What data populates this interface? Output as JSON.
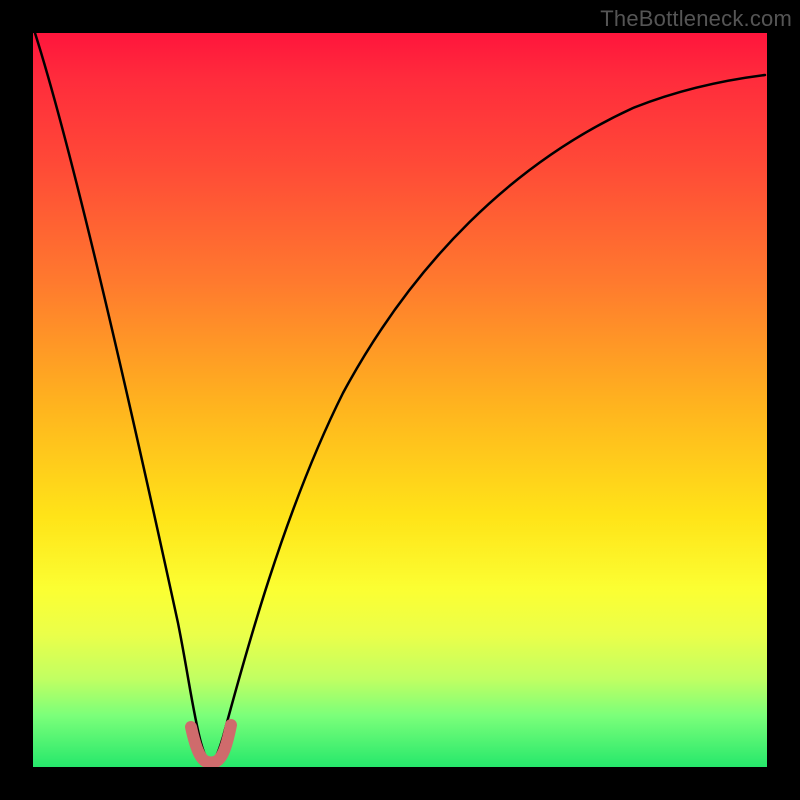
{
  "watermark": "TheBottleneck.com",
  "chart_data": {
    "type": "line",
    "title": "",
    "xlabel": "",
    "ylabel": "",
    "xlim": [
      0,
      100
    ],
    "ylim": [
      0,
      100
    ],
    "grid": false,
    "legend": false,
    "series": [
      {
        "name": "bottleneck-curve",
        "color": "#000000",
        "x": [
          0,
          4,
          8,
          12,
          16,
          18,
          20,
          21,
          22,
          23,
          24,
          25,
          26,
          28,
          32,
          36,
          40,
          46,
          52,
          60,
          70,
          80,
          90,
          100
        ],
        "y": [
          100,
          84,
          68,
          52,
          32,
          20,
          8,
          3,
          1,
          0.5,
          1,
          3,
          8,
          18,
          35,
          48,
          58,
          68,
          75,
          81,
          86,
          89,
          91,
          92
        ]
      },
      {
        "name": "highlight-mark",
        "color": "#cf6b6c",
        "x": [
          20.5,
          21,
          21.5,
          22,
          22.5,
          23,
          23.5,
          24,
          24.5,
          25,
          25.5
        ],
        "y": [
          5,
          3,
          1.5,
          0.8,
          0.5,
          0.5,
          0.8,
          1.5,
          3,
          4.5,
          6
        ]
      }
    ],
    "gradient_scale": {
      "top_color": "#ff153c",
      "mid_color_1": "#ff7a2e",
      "mid_color_2": "#ffe418",
      "bottom_color": "#26e86b"
    }
  }
}
